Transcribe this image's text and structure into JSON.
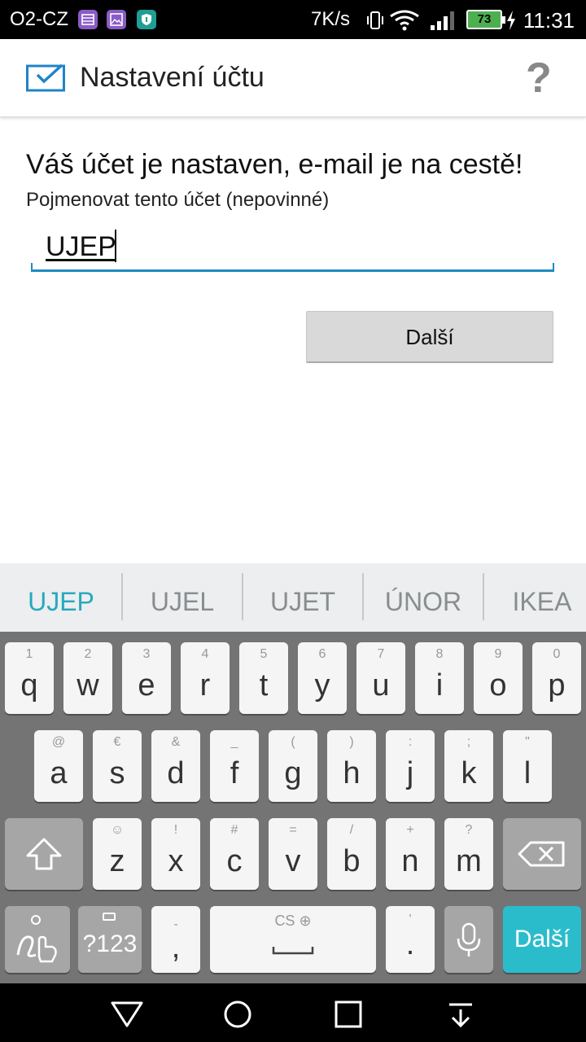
{
  "status_bar": {
    "carrier": "O2-CZ",
    "speed": "7K/s",
    "battery": "73",
    "time": "11:31"
  },
  "app_bar": {
    "title": "Nastavení účtu",
    "help": "?"
  },
  "content": {
    "headline": "Váš účet je nastaven, e-mail je na cestě!",
    "field_label": "Pojmenovat tento účet (nepovinné)",
    "field_value": "UJEP",
    "next_button": "Další"
  },
  "suggestions": [
    "UJEP",
    "UJEL",
    "UJET",
    "ÚNOR",
    "IKEA"
  ],
  "keyboard": {
    "row1": [
      {
        "k": "q",
        "h": "1"
      },
      {
        "k": "w",
        "h": "2"
      },
      {
        "k": "e",
        "h": "3"
      },
      {
        "k": "r",
        "h": "4"
      },
      {
        "k": "t",
        "h": "5"
      },
      {
        "k": "y",
        "h": "6"
      },
      {
        "k": "u",
        "h": "7"
      },
      {
        "k": "i",
        "h": "8"
      },
      {
        "k": "o",
        "h": "9"
      },
      {
        "k": "p",
        "h": "0"
      }
    ],
    "row2": [
      {
        "k": "a",
        "h": "@"
      },
      {
        "k": "s",
        "h": "€"
      },
      {
        "k": "d",
        "h": "&"
      },
      {
        "k": "f",
        "h": "_"
      },
      {
        "k": "g",
        "h": "("
      },
      {
        "k": "h",
        "h": ")"
      },
      {
        "k": "j",
        "h": ":"
      },
      {
        "k": "k",
        "h": ";"
      },
      {
        "k": "l",
        "h": "\""
      }
    ],
    "row3": [
      {
        "k": "z",
        "h": "☺"
      },
      {
        "k": "x",
        "h": "!"
      },
      {
        "k": "c",
        "h": "#"
      },
      {
        "k": "v",
        "h": "="
      },
      {
        "k": "b",
        "h": "/"
      },
      {
        "k": "n",
        "h": "+"
      },
      {
        "k": "m",
        "h": "?"
      }
    ],
    "symbols_key": "?123",
    "comma_key": ",",
    "comma_hint": "-",
    "space_hint": "CS",
    "period_key": ".",
    "period_hint": "'",
    "action_key": "Další"
  },
  "colors": {
    "accent": "#26a9bd",
    "input_underline": "#1e8bc3",
    "action_key": "#2bbccc",
    "keyboard_bg": "#747474"
  }
}
